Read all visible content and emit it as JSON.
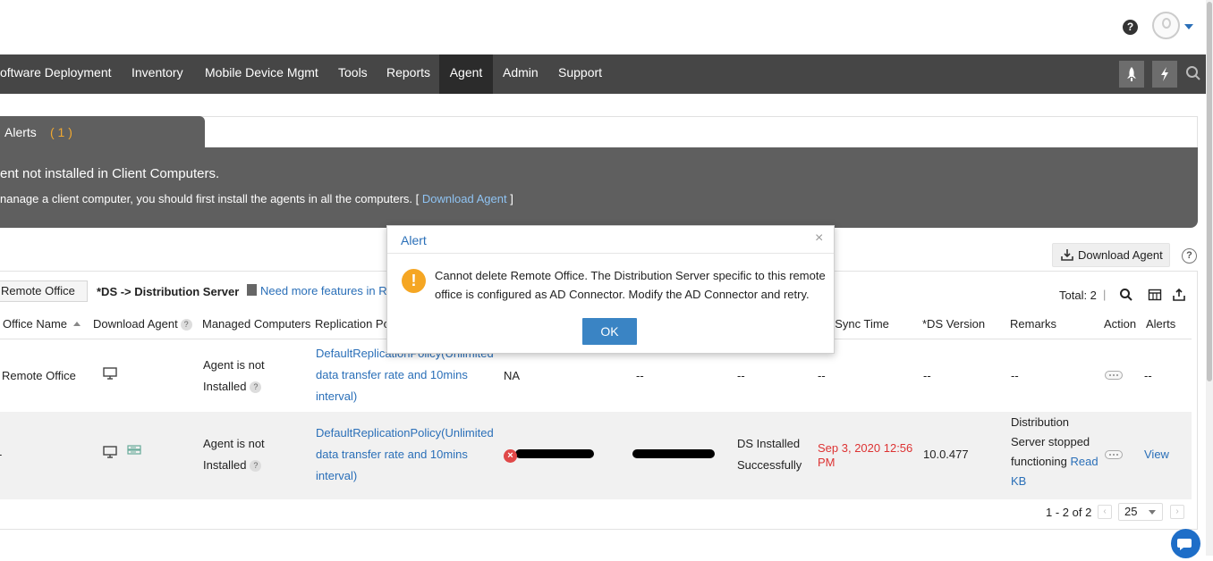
{
  "header": {
    "help_icon": "help-icon",
    "avatar": "user-avatar"
  },
  "nav": {
    "items": [
      {
        "label": "oftware Deployment"
      },
      {
        "label": "Inventory"
      },
      {
        "label": "Mobile Device Mgmt"
      },
      {
        "label": "Tools"
      },
      {
        "label": "Reports"
      },
      {
        "label": "Agent",
        "active": true
      },
      {
        "label": "Admin"
      },
      {
        "label": "Support"
      }
    ],
    "buttons": [
      "rocket-icon",
      "lightning-icon",
      "search-icon"
    ]
  },
  "alerts_tab": {
    "label": "Alerts",
    "count": "( 1 )"
  },
  "banner": {
    "title": "ent not installed in Client Computers.",
    "message_prefix": "nanage a client computer, you should first install the agents in all the computers. [ ",
    "link": "Download Agent",
    "message_suffix": " ]"
  },
  "toolbar": {
    "download_agent": "Download Agent",
    "remote_office": "Remote Office",
    "ds_legend": "*DS -> Distribution Server",
    "features_link": "Need more features in Re",
    "total": "Total: 2",
    "total_sep": "|"
  },
  "table": {
    "headers": {
      "office_name": "Office Name",
      "download_agent": "Download Agent",
      "managed_computers": "Managed Computers",
      "replication_policy": "Replication Po",
      "last_sync": "t Sync Time",
      "ds_version": "*DS Version",
      "remarks": "Remarks",
      "action": "Action",
      "alerts": "Alerts"
    },
    "rows": [
      {
        "office_name": "Remote Office",
        "managed_line1": "Agent is not",
        "managed_line2": "Installed",
        "policy_line1": "DefaultReplicationPolicy(Unlimited",
        "policy_line2": "data transfer rate and 10mins",
        "policy_line3": "interval)",
        "col5": "NA",
        "col6": "--",
        "col7": "--",
        "last_sync": "--",
        "ds_version": "--",
        "remarks": "--",
        "alerts": "--"
      },
      {
        "office_name": "-",
        "managed_line1": "Agent is not",
        "managed_line2": "Installed",
        "policy_line1": "DefaultReplicationPolicy(Unlimited",
        "policy_line2": "data transfer rate and 10mins",
        "policy_line3": "interval)",
        "status_line1": "DS Installed",
        "status_line2": "Successfully",
        "last_sync_line1": "Sep 3, 2020 12:56",
        "last_sync_line2": "PM",
        "ds_version": "10.0.477",
        "remarks_line1": "Distribution",
        "remarks_line2": "Server stopped",
        "remarks_line3": "functioning",
        "remarks_link1": "Read",
        "remarks_link2": "KB",
        "alerts_link": "View"
      }
    ]
  },
  "pager": {
    "range": "1 - 2 of 2",
    "page_size": "25",
    "prev": "‹",
    "next": "›"
  },
  "modal": {
    "title": "Alert",
    "close": "×",
    "message": "Cannot delete Remote Office. The Distribution Server specific to this remote office is configured as AD Connector. Modify the AD Connector and retry.",
    "ok": "OK"
  },
  "colors": {
    "accent": "#2a6fb8",
    "nav_bg": "#464646",
    "banner_bg": "#5f5f5f",
    "warn": "#f5a623",
    "ok_button": "#3a84c4",
    "error_text": "#d33"
  }
}
